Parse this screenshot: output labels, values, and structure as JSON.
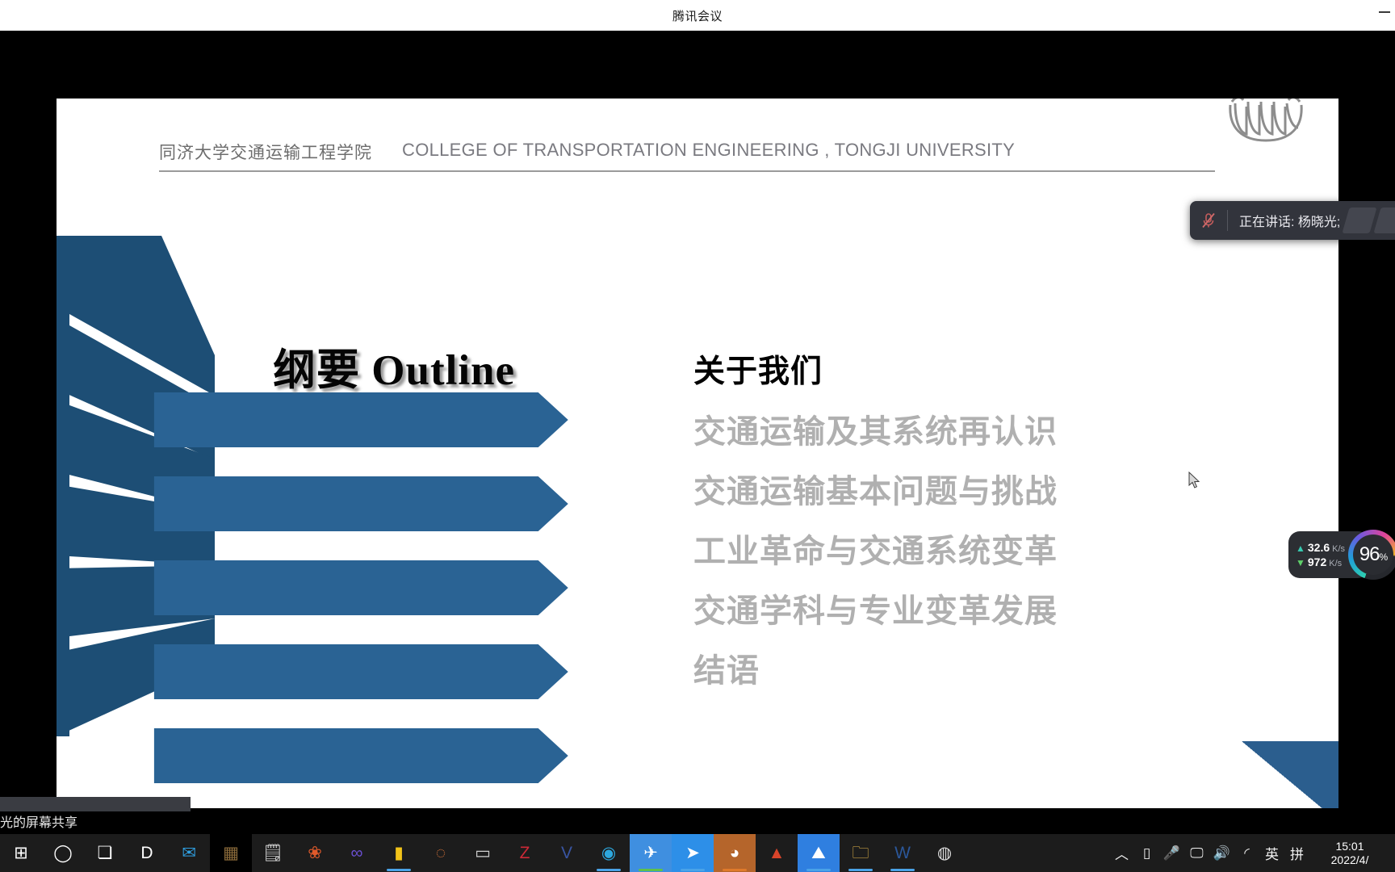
{
  "window": {
    "title": "腾讯会议",
    "minimize_label": "—"
  },
  "slide": {
    "header_cn": "同济大学交通运输工程学院",
    "header_en": "COLLEGE OF TRANSPORTATION ENGINEERING , TONGJI UNIVERSITY",
    "logo_name": "tongji-university-seal",
    "title": "纲要  Outline",
    "items": [
      {
        "label": "关于我们",
        "state": "active"
      },
      {
        "label": "交通运输及其系统再认识",
        "state": "inactive"
      },
      {
        "label": "交通运输基本问题与挑战",
        "state": "inactive"
      },
      {
        "label": "工业革命与交通系统变革",
        "state": "inactive"
      },
      {
        "label": "交通学科与专业变革发展",
        "state": "inactive"
      },
      {
        "label": "结语",
        "state": "inactive"
      }
    ],
    "colors": {
      "bar_blue": "#2a6394",
      "fan_navy": "#1d4e75",
      "corner_blue": "#2b5e8e",
      "header_grey": "#6d6d6d",
      "item_grey": "#b0b0b0",
      "item_active": "#000000"
    }
  },
  "speaking_banner": {
    "text": "正在讲话: 杨晓光;",
    "mic_icon": "microphone-muted-icon"
  },
  "network_widget": {
    "upload": {
      "value": "32.6",
      "unit": "K/s",
      "arrow": "up-arrow-icon"
    },
    "download": {
      "value": "972",
      "unit": "K/s",
      "arrow": "down-arrow-icon"
    },
    "gauge_percent": "96",
    "gauge_percent_symbol": "%"
  },
  "share_bar": {
    "text": "光的屏幕共享"
  },
  "taskbar": {
    "icons": [
      {
        "name": "windows-start-icon",
        "glyph": "⊞",
        "color": "#ffffff",
        "bg": "",
        "underline": ""
      },
      {
        "name": "search-icon",
        "glyph": "◯",
        "color": "#ffffff",
        "bg": "",
        "underline": ""
      },
      {
        "name": "task-view-icon",
        "glyph": "❏",
        "color": "#ffffff",
        "bg": "",
        "underline": ""
      },
      {
        "name": "dell-icon",
        "glyph": "D",
        "color": "#ffffff",
        "bg": "",
        "underline": ""
      },
      {
        "name": "mail-icon",
        "glyph": "✉",
        "color": "#2f9fe0",
        "bg": "",
        "underline": ""
      },
      {
        "name": "pixel-app-icon",
        "glyph": "▦",
        "color": "#8a6a3a",
        "bg": "#000000",
        "underline": ""
      },
      {
        "name": "python-script-icon",
        "glyph": "🗒",
        "color": "#e0e0e0",
        "bg": "",
        "underline": ""
      },
      {
        "name": "colorful-flower-icon",
        "glyph": "❀",
        "color": "#e05a2b",
        "bg": "",
        "underline": ""
      },
      {
        "name": "infinity-app-icon",
        "glyph": "∞",
        "color": "#6a4fd0",
        "bg": "",
        "underline": ""
      },
      {
        "name": "sticky-notes-icon",
        "glyph": "▮",
        "color": "#f2c319",
        "bg": "",
        "underline": "#4aa3e8"
      },
      {
        "name": "clash-icon",
        "glyph": "◌",
        "color": "#d9743a",
        "bg": "",
        "underline": ""
      },
      {
        "name": "command-prompt-icon",
        "glyph": "▭",
        "color": "#cfcfcf",
        "bg": "",
        "underline": ""
      },
      {
        "name": "zotero-icon",
        "glyph": "Z",
        "color": "#cc2936",
        "bg": "",
        "underline": ""
      },
      {
        "name": "visio-icon",
        "glyph": "V",
        "color": "#3955a3",
        "bg": "",
        "underline": ""
      },
      {
        "name": "edge-icon",
        "glyph": "◉",
        "color": "#2da7dd",
        "bg": "",
        "underline": "#4aa3e8"
      },
      {
        "name": "tencent-meeting-icon",
        "glyph": "✈",
        "color": "#ffffff",
        "bg": "#3f8fe0",
        "underline": "#5fc14a"
      },
      {
        "name": "wemeet-companion-icon",
        "glyph": "➤",
        "color": "#ffffff",
        "bg": "#2d8fe8",
        "underline": "#4aa3e8"
      },
      {
        "name": "tiger-app-icon",
        "glyph": "◕",
        "color": "#ffffff",
        "bg": "#b5652b",
        "underline": "#e07a2b"
      },
      {
        "name": "matlab-icon",
        "glyph": "▲",
        "color": "#d8442a",
        "bg": "",
        "underline": ""
      },
      {
        "name": "mountain-app-icon",
        "glyph": "⛰",
        "color": "#ffffff",
        "bg": "#2f7fe0",
        "underline": "#4aa3e8"
      },
      {
        "name": "file-explorer-icon",
        "glyph": "🗀",
        "color": "#e8b84b",
        "bg": "",
        "underline": "#4aa3e8"
      },
      {
        "name": "word-icon",
        "glyph": "W",
        "color": "#2b579a",
        "bg": "",
        "underline": "#4aa3e8"
      },
      {
        "name": "obs-studio-icon",
        "glyph": "◍",
        "color": "#dddddd",
        "bg": "",
        "underline": ""
      }
    ],
    "tray": [
      {
        "name": "show-hidden-icons-chevron",
        "glyph": "︿"
      },
      {
        "name": "usb-device-icon",
        "glyph": "▯"
      },
      {
        "name": "microphone-icon",
        "glyph": "🎤"
      },
      {
        "name": "screen-cast-icon",
        "glyph": "🖵"
      },
      {
        "name": "volume-icon",
        "glyph": "🔊"
      },
      {
        "name": "wifi-icon",
        "glyph": "◜"
      },
      {
        "name": "ime-english-icon",
        "glyph": "英"
      },
      {
        "name": "ime-pinyin-icon",
        "glyph": "拼"
      }
    ],
    "clock": {
      "time": "15:01",
      "date": "2022/4/"
    }
  }
}
